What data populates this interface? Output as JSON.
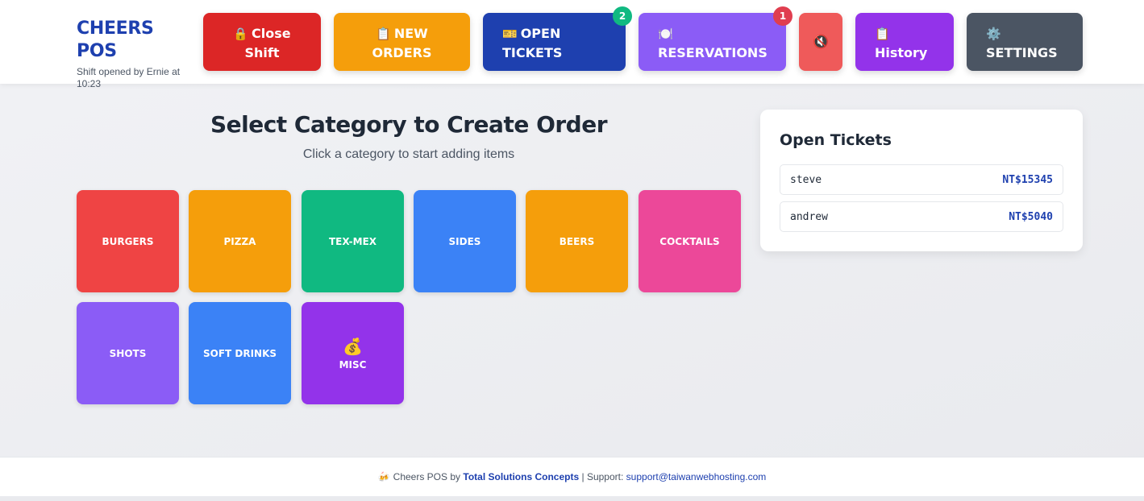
{
  "brand": {
    "title": "CHEERS POS",
    "subtitle": "Shift opened by Ernie at 10:23"
  },
  "nav": {
    "close_shift": {
      "icon": "🔒",
      "label": "Close Shift",
      "color": "#dc2626"
    },
    "new_orders": {
      "icon": "📋",
      "label": "NEW ORDERS",
      "color": "#f59e0b"
    },
    "open_tickets": {
      "icon": "🎫",
      "label": "OPEN TICKETS",
      "color": "#1e40af",
      "badge": "2",
      "badge_color": "#10b981"
    },
    "reservations": {
      "icon": "🍽️",
      "label": "RESERVATIONS",
      "color": "#8b5cf6",
      "badge": "1",
      "badge_color": "#e03e4f"
    },
    "mute": {
      "icon": "🔇",
      "color": "#ef5a5a"
    },
    "history": {
      "icon": "📋",
      "label": "History",
      "color": "#9333ea"
    },
    "settings": {
      "icon": "⚙️",
      "label": "SETTINGS",
      "color": "#4b5563"
    }
  },
  "main": {
    "title": "Select Category to Create Order",
    "subtitle": "Click a category to start adding items"
  },
  "categories": [
    {
      "label": "BURGERS",
      "color": "#ef4444"
    },
    {
      "label": "PIZZA",
      "color": "#f59e0b"
    },
    {
      "label": "TEX-MEX",
      "color": "#10b981"
    },
    {
      "label": "SIDES",
      "color": "#3b82f6"
    },
    {
      "label": "BEERS",
      "color": "#f59e0b"
    },
    {
      "label": "COCKTAILS",
      "color": "#ec4899"
    },
    {
      "label": "SHOTS",
      "color": "#8b5cf6"
    },
    {
      "label": "SOFT DRINKS",
      "color": "#3b82f6"
    },
    {
      "label": "MISC",
      "icon": "💰",
      "color": "#9333ea"
    }
  ],
  "open_tickets": {
    "title": "Open Tickets",
    "items": [
      {
        "name": "steve",
        "amount": "NT$15345"
      },
      {
        "name": "andrew",
        "amount": "NT$5040"
      }
    ]
  },
  "footer": {
    "icon": "🍻",
    "prefix": "Cheers POS by",
    "company": "Total Solutions Concepts",
    "support_label": "| Support:",
    "email": "support@taiwanwebhosting.com"
  }
}
